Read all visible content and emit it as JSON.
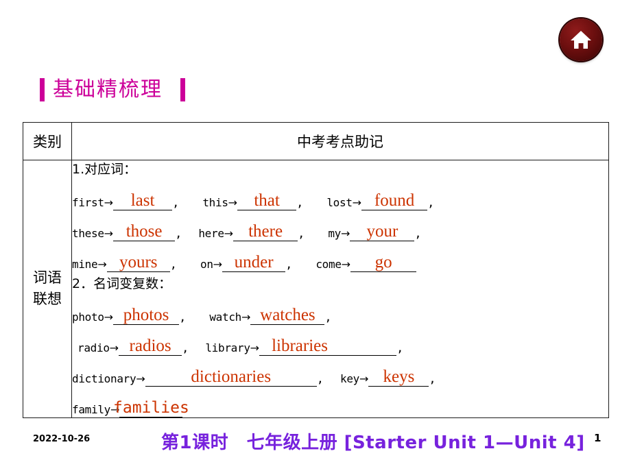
{
  "home_button": {
    "icon": "home-icon",
    "color": "#6d0f0f"
  },
  "section": {
    "title": "基础精梳理",
    "accent_color": "#cc0099"
  },
  "table": {
    "headers": {
      "category": "类别",
      "main": "中考考点助记"
    },
    "category_label_line1": "词语",
    "category_label_line2": "联想",
    "groups": [
      {
        "heading": "1.对应词：",
        "rows": [
          [
            {
              "prompt": "first",
              "arrow": "→",
              "answer": "last",
              "blank_width": 86,
              "trailing": ","
            },
            {
              "prompt": "this",
              "arrow": "→",
              "answer": "that",
              "blank_width": 86,
              "trailing": ","
            },
            {
              "prompt": "lost",
              "arrow": "→",
              "answer": "found",
              "blank_width": 96,
              "trailing": ","
            }
          ],
          [
            {
              "prompt": "these",
              "arrow": "→",
              "answer": "those",
              "blank_width": 90,
              "trailing": ","
            },
            {
              "prompt": "here",
              "arrow": "→",
              "answer": "there",
              "blank_width": 94,
              "trailing": ","
            },
            {
              "prompt": "my",
              "arrow": "→",
              "answer": "your",
              "blank_width": 94,
              "trailing": ","
            }
          ],
          [
            {
              "prompt": "mine",
              "arrow": "→",
              "answer": "yours",
              "blank_width": 92,
              "trailing": ","
            },
            {
              "prompt": "on",
              "arrow": "→",
              "answer": "under",
              "blank_width": 92,
              "trailing": ","
            },
            {
              "prompt": "come",
              "arrow": "→",
              "answer": "go",
              "blank_width": 96,
              "trailing": ""
            }
          ]
        ]
      },
      {
        "heading": "2．名词变复数：",
        "rows": [
          [
            {
              "prompt": "photo",
              "arrow": "→",
              "answer": "photos",
              "blank_width": 96,
              "trailing": ","
            },
            {
              "prompt": "watch",
              "arrow": "→",
              "answer": "watches",
              "blank_width": 108,
              "trailing": ","
            }
          ],
          [
            {
              "prompt": "radio",
              "arrow": "→",
              "answer": "radios",
              "blank_width": 92,
              "trailing": ","
            },
            {
              "prompt": "library",
              "arrow": "→",
              "answer": "libraries",
              "blank_width": 200,
              "trailing": ","
            }
          ],
          [
            {
              "prompt": "dictionary",
              "arrow": "→",
              "answer": "dictionaries",
              "blank_width": 250,
              "trailing": ","
            },
            {
              "prompt": "key",
              "arrow": "→",
              "answer": "keys",
              "blank_width": 88,
              "trailing": ","
            }
          ],
          [
            {
              "prompt": "family",
              "arrow": "→",
              "answer": "families",
              "blank_width": 92,
              "trailing": "",
              "mono": true
            }
          ]
        ]
      }
    ]
  },
  "footer": {
    "date": "2022-10-26",
    "title": "第1课时　七年级上册 [Starter Unit 1—Unit 4]",
    "title_color": "#7722dd",
    "page_number": "1"
  }
}
